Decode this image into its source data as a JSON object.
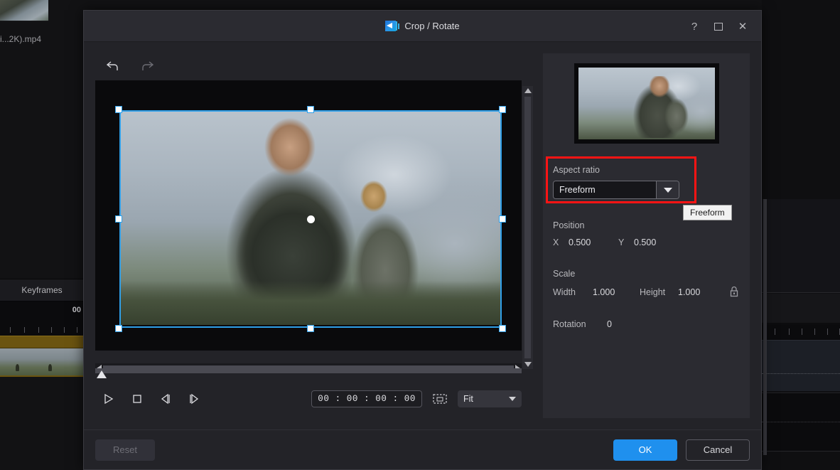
{
  "background": {
    "media_filename": "i...2K).mp4",
    "keyframes_label": "Keyframes",
    "timeline_timecode": "00"
  },
  "dialog": {
    "title": "Crop / Rotate",
    "app_icon": "crop-rotate-app-icon",
    "window_controls": {
      "help": "?",
      "maximize": "maximize-icon",
      "close": "✕"
    },
    "toolbar": {
      "undo": "undo-icon",
      "redo": "redo-icon"
    },
    "preview": {
      "center_handle": "center-move-handle",
      "crop_border_color": "#2f9fe8"
    },
    "playback": {
      "play": "play-icon",
      "stop": "stop-icon",
      "prev_frame": "previous-frame-icon",
      "next_frame": "next-frame-icon",
      "timecode": "00 : 00 : 00 : 00",
      "snapshot": "snapshot-icon",
      "zoom_mode": "Fit",
      "zoom_options": [
        "Fit"
      ]
    },
    "properties": {
      "aspect_ratio_label": "Aspect ratio",
      "aspect_ratio_value": "Freeform",
      "aspect_ratio_options": [
        "Freeform"
      ],
      "aspect_highlight_color": "#ff1414",
      "tooltip": "Freeform",
      "position_label": "Position",
      "position_x_label": "X",
      "position_x_value": "0.500",
      "position_y_label": "Y",
      "position_y_value": "0.500",
      "scale_label": "Scale",
      "scale_width_label": "Width",
      "scale_width_value": "1.000",
      "scale_height_label": "Height",
      "scale_height_value": "1.000",
      "lock_aspect_icon": "lock-icon",
      "rotation_label": "Rotation",
      "rotation_value": "0"
    },
    "footer": {
      "reset": "Reset",
      "ok": "OK",
      "cancel": "Cancel",
      "ok_color": "#1f90ee"
    }
  }
}
